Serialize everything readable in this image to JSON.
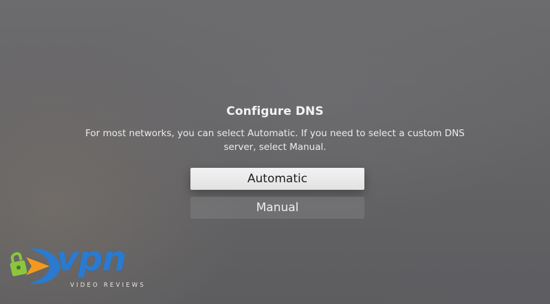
{
  "dialog": {
    "title": "Configure DNS",
    "message": "For most networks, you can select Automatic. If you need to select a custom DNS server, select Manual."
  },
  "options": [
    {
      "label": "Automatic",
      "focused": true
    },
    {
      "label": "Manual",
      "focused": false
    }
  ],
  "watermark": {
    "logo_text": "vpn",
    "subtitle": "VIDEO REVIEWS",
    "icon": "lock-arrow-icon"
  },
  "colors": {
    "focused_option_bg": "#ececec",
    "unfocused_option_bg": "#7d7d80",
    "text": "#f3f3f3",
    "logo_blue": "#2a7bd0",
    "logo_orange": "#f39a1e",
    "logo_green": "#8cc63f"
  }
}
